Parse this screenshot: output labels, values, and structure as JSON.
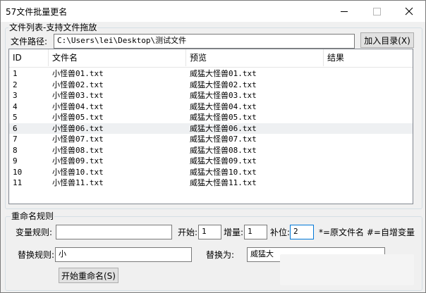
{
  "window": {
    "title": "57文件批量更名"
  },
  "file_group": {
    "label": "文件列表-支持文件拖放",
    "path_label": "文件路径:",
    "path_value": "C:\\Users\\lei\\Desktop\\测试文件",
    "add_button": "加入目录(X)"
  },
  "list": {
    "headers": [
      "ID",
      "文件名",
      "预览",
      "结果"
    ],
    "rows": [
      {
        "id": "1",
        "name": "小怪兽01.txt",
        "preview": "威猛大怪兽01.txt",
        "result": ""
      },
      {
        "id": "2",
        "name": "小怪兽02.txt",
        "preview": "威猛大怪兽02.txt",
        "result": ""
      },
      {
        "id": "3",
        "name": "小怪兽03.txt",
        "preview": "威猛大怪兽03.txt",
        "result": ""
      },
      {
        "id": "4",
        "name": "小怪兽04.txt",
        "preview": "威猛大怪兽04.txt",
        "result": ""
      },
      {
        "id": "5",
        "name": "小怪兽05.txt",
        "preview": "威猛大怪兽05.txt",
        "result": ""
      },
      {
        "id": "6",
        "name": "小怪兽06.txt",
        "preview": "威猛大怪兽06.txt",
        "result": ""
      },
      {
        "id": "7",
        "name": "小怪兽07.txt",
        "preview": "威猛大怪兽07.txt",
        "result": ""
      },
      {
        "id": "8",
        "name": "小怪兽08.txt",
        "preview": "威猛大怪兽08.txt",
        "result": ""
      },
      {
        "id": "9",
        "name": "小怪兽09.txt",
        "preview": "威猛大怪兽09.txt",
        "result": ""
      },
      {
        "id": "10",
        "name": "小怪兽10.txt",
        "preview": "威猛大怪兽10.txt",
        "result": ""
      },
      {
        "id": "11",
        "name": "小怪兽11.txt",
        "preview": "威猛大怪兽11.txt",
        "result": ""
      }
    ]
  },
  "rules_group": {
    "label": "重命名规则",
    "var_rule_label": "变量规则:",
    "var_rule_value": "",
    "start_label": "开始:",
    "start_value": "1",
    "increment_label": "增量:",
    "increment_value": "1",
    "padding_label": "补位:",
    "padding_value": "2",
    "legend_text": "*=原文件名 #=自增变量",
    "replace_label": "替换规则:",
    "replace_value": "小",
    "replace_with_label": "替换为:",
    "replace_with_value": "威猛大",
    "start_button": "开始重命名(S)"
  }
}
